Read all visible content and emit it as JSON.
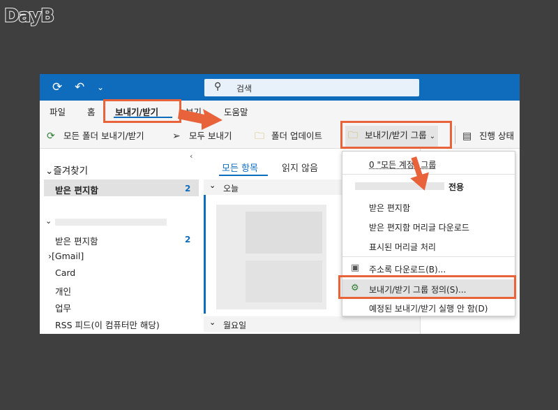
{
  "watermark": "DayB",
  "titlebar": {
    "sync_icon": "sync-icon",
    "undo_icon": "undo-icon",
    "customize_icon": "dropdown-icon",
    "search_placeholder": "검색"
  },
  "menu": {
    "tabs": [
      "파일",
      "홈",
      "보내기/받기",
      "보기",
      "도움말"
    ],
    "active": "보내기/받기"
  },
  "toolbar": {
    "send_receive_all": "모든 폴더 보내기/받기",
    "send_all": "모두 보내기",
    "update_folder": "폴더 업데이트",
    "send_receive_groups": "보내기/받기 그룹",
    "progress": "진행 상태"
  },
  "nav": {
    "favorites_title": "즐겨찾기",
    "favorites_inbox": "받은 편지함",
    "favorites_inbox_count": "2",
    "account_inbox": "받은 편지함",
    "account_inbox_count": "2",
    "folders": [
      "[Gmail]",
      "Card",
      "개인",
      "업무",
      "RSS 피드(이 컴퓨터만 해당)"
    ]
  },
  "message_list": {
    "tab_all": "모든 항목",
    "tab_unread": "읽지 않음",
    "group_today": "오늘",
    "group_monday": "월요일"
  },
  "dropdown": {
    "all_accounts_group": "0 \"모든 계정\" 그룹",
    "account_only_suffix": "전용",
    "inbox": "받은 편지함",
    "download_inbox_headers": "받은 편지함 머리글 다운로드",
    "process_marked_headers": "표시된 머리글 처리",
    "download_address_book": "주소록 다운로드(B)...",
    "define_groups": "보내기/받기 그룹 정의(S)...",
    "disable_scheduled": "예정된 보내기/받기 실행 안 함(D)"
  },
  "colors": {
    "accent": "#0f6cbd",
    "highlight": "#e8623a",
    "background": "#3f3f3f"
  }
}
